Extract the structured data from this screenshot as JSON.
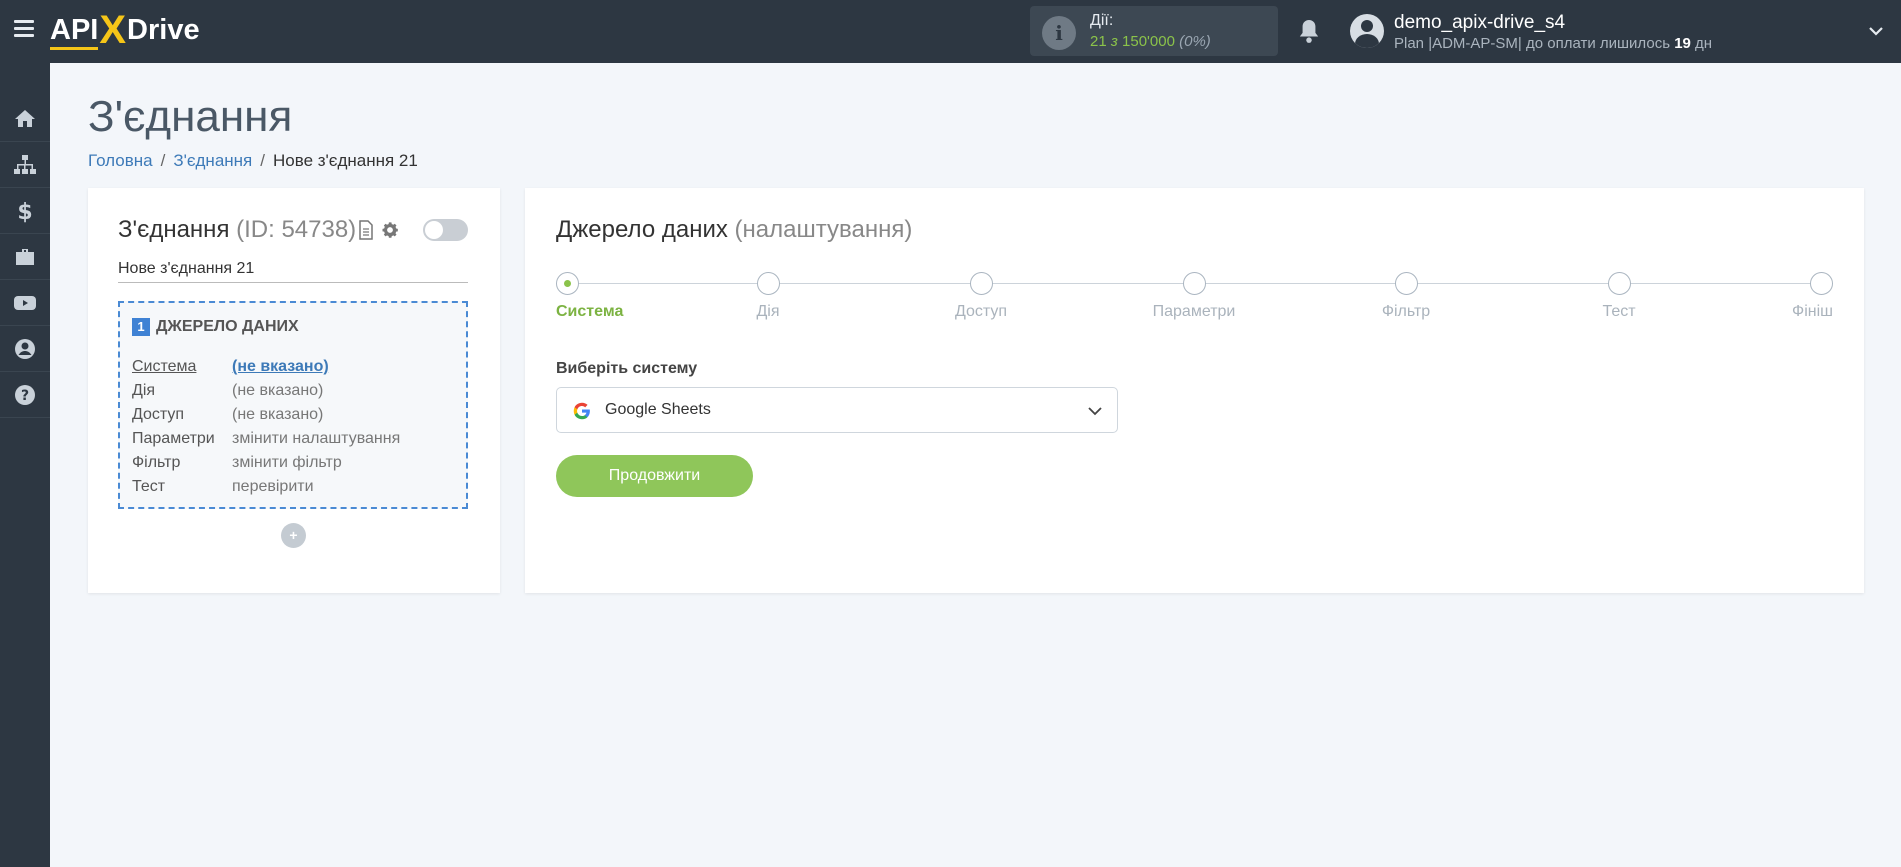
{
  "header": {
    "logo": {
      "part1": "API",
      "part2": "X",
      "part3": "Drive"
    },
    "actions": {
      "label": "Дії:",
      "used": "21",
      "separator": "з",
      "total": "150'000",
      "percent": "(0%)"
    },
    "user": {
      "name": "demo_apix-drive_s4",
      "plan_prefix": "Plan |ADM-AP-SM| до оплати лишилось",
      "days": "19",
      "days_unit": "дн"
    }
  },
  "page": {
    "title": "З'єднання",
    "breadcrumb": {
      "home": "Головна",
      "connections": "З'єднання",
      "current": "Нове з'єднання 21"
    }
  },
  "connection": {
    "title": "З'єднання",
    "id_text": "(ID: 54738)",
    "name": "Нове з'єднання 21",
    "source_number": "1",
    "source_label": "ДЖЕРЕЛО ДАНИХ",
    "rows": [
      {
        "key": "Система",
        "value": "(не вказано)"
      },
      {
        "key": "Дія",
        "value": "(не вказано)"
      },
      {
        "key": "Доступ",
        "value": "(не вказано)"
      },
      {
        "key": "Параметри",
        "value": "змінити налаштування"
      },
      {
        "key": "Фільтр",
        "value": "змінити фільтр"
      },
      {
        "key": "Тест",
        "value": "перевірити"
      }
    ],
    "add_symbol": "+"
  },
  "source_settings": {
    "title": "Джерело даних",
    "subtitle": "(налаштування)",
    "steps": [
      "Система",
      "Дія",
      "Доступ",
      "Параметри",
      "Фільтр",
      "Тест",
      "Фініш"
    ],
    "active_step_index": 0,
    "select_label": "Виберіть систему",
    "selected_system": "Google Sheets",
    "continue_label": "Продовжити"
  },
  "colors": {
    "topbar": "#2d3742",
    "accent_green": "#8bc34a",
    "link_blue": "#3d7ab8",
    "logo_yellow": "#f5c518"
  }
}
